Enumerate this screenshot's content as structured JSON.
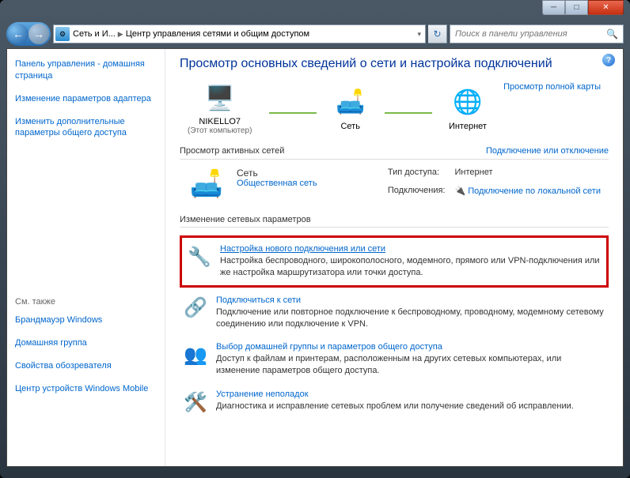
{
  "titlebar": {
    "min": "─",
    "max": "□",
    "close": "✕"
  },
  "breadcrumb": {
    "part1": "Сеть и И...",
    "part2": "Центр управления сетями и общим доступом"
  },
  "search": {
    "placeholder": "Поиск в панели управления"
  },
  "sidebar": {
    "home": "Панель управления - домашняя страница",
    "adapter": "Изменение параметров адаптера",
    "sharing": "Изменить дополнительные параметры общего доступа",
    "see_also": "См. также",
    "links": {
      "firewall": "Брандмауэр Windows",
      "homegroup": "Домашняя группа",
      "ie": "Свойства обозревателя",
      "mobile": "Центр устройств Windows Mobile"
    }
  },
  "main": {
    "title": "Просмотр основных сведений о сети и настройка подключений",
    "map_full": "Просмотр полной карты",
    "computer": {
      "name": "NIKELLO7",
      "sub": "(Этот компьютер)"
    },
    "network": "Сеть",
    "internet": "Интернет",
    "active_nets_title": "Просмотр активных сетей",
    "connect_disconnect": "Подключение или отключение",
    "net": {
      "name": "Сеть",
      "type": "Общественная сеть",
      "access_label": "Тип доступа:",
      "access_val": "Интернет",
      "conn_label": "Подключения:",
      "conn_val": "Подключение по локальной сети"
    },
    "change_settings": "Изменение сетевых параметров",
    "items": {
      "setup": {
        "link": "Настройка нового подключения или сети",
        "desc": "Настройка беспроводного, широкополосного, модемного, прямого или VPN-подключения или же настройка маршрутизатора или точки доступа."
      },
      "connect": {
        "link": "Подключиться к сети",
        "desc": "Подключение или повторное подключение к беспроводному, проводному, модемному сетевому соединению или подключение к VPN."
      },
      "homegroup": {
        "link": "Выбор домашней группы и параметров общего доступа",
        "desc": "Доступ к файлам и принтерам, расположенным на других сетевых компьютерах, или изменение параметров общего доступа."
      },
      "troubleshoot": {
        "link": "Устранение неполадок",
        "desc": "Диагностика и исправление сетевых проблем или получение сведений об исправлении."
      }
    }
  }
}
